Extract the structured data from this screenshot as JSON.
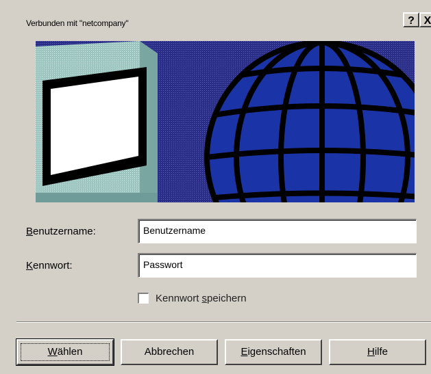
{
  "dialog": {
    "title": "Verbunden mit \"netcompany\"",
    "help_glyph": "?",
    "close_glyph": "X"
  },
  "banner": {
    "icons": [
      "computer-monitor-icon",
      "globe-icon"
    ]
  },
  "form": {
    "username": {
      "mnemonic": "B",
      "label_rest": "enutzername:",
      "value": "Benutzername"
    },
    "password": {
      "mnemonic": "K",
      "label_rest": "ennwort:",
      "value": "Passwort"
    },
    "save_password": {
      "label_before": "Kennwort ",
      "mnemonic": "s",
      "label_after": "peichern",
      "checked": false
    }
  },
  "buttons": {
    "dial": {
      "before": "",
      "mnemonic": "W",
      "after": "ählen"
    },
    "cancel": {
      "label": "Abbrechen"
    },
    "properties": {
      "before": "",
      "mnemonic": "E",
      "after": "igenschaften"
    },
    "help": {
      "before": "",
      "mnemonic": "H",
      "after": "ilfe"
    }
  },
  "colors": {
    "dialog_bg": "#d4d0c8",
    "banner_bg": "#2b2f8a",
    "globe": "#1b35a8",
    "monitor": "#9fc6c2"
  }
}
